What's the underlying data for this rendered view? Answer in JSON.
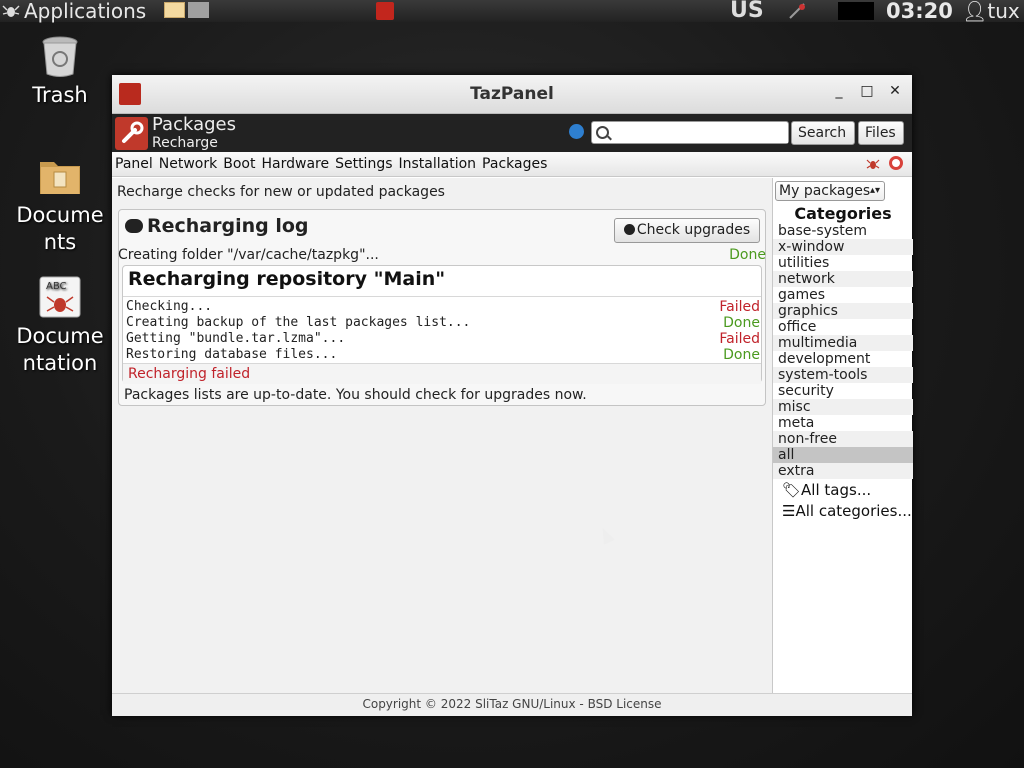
{
  "topbar": {
    "applications_label": "Applications",
    "keyboard_layout": "US",
    "clock": "03:20",
    "user": "tux"
  },
  "desktop": {
    "icons": [
      {
        "label": "Trash"
      },
      {
        "label": "Documents"
      },
      {
        "label": "Documentation"
      }
    ]
  },
  "window": {
    "title": "TazPanel",
    "minimize": "_",
    "maximize": "□",
    "close": "✕",
    "header": {
      "title": "Packages",
      "subtitle": "Recharge",
      "search_placeholder": "",
      "search_button": "Search",
      "files_button": "Files"
    },
    "menu": [
      "Panel",
      "Network",
      "Boot",
      "Hardware",
      "Settings",
      "Installation",
      "Packages"
    ],
    "main": {
      "description": "Recharge checks for new or updated packages",
      "log_title": "Recharging log",
      "check_upgrades": "Check upgrades",
      "creating_folder": "Creating folder \"/var/cache/tazpkg\"...",
      "creating_folder_status": "Done",
      "repo_title": "Recharging repository \"Main\"",
      "steps": [
        {
          "text": "Checking...",
          "status": "Failed"
        },
        {
          "text": "Creating backup of the last packages list...",
          "status": "Done"
        },
        {
          "text": "Getting \"bundle.tar.lzma\"...",
          "status": "Failed"
        },
        {
          "text": "Restoring database files...",
          "status": "Done"
        }
      ],
      "repo_result": "Recharging failed",
      "final_message": "Packages lists are up-to-date. You should check for upgrades now."
    },
    "sidebar": {
      "select_value": "My packages",
      "categories_heading": "Categories",
      "categories": [
        "base-system",
        "x-window",
        "utilities",
        "network",
        "games",
        "graphics",
        "office",
        "multimedia",
        "development",
        "system-tools",
        "security",
        "misc",
        "meta",
        "non-free",
        "all",
        "extra"
      ],
      "selected_category": "all",
      "all_tags": "All tags...",
      "all_categories": "All categories..."
    },
    "footer": "Copyright © 2022 SliTaz GNU/Linux - BSD License"
  },
  "colors": {
    "done": "#4b9a1f",
    "failed": "#c0222a",
    "accent": "#c0392b"
  }
}
